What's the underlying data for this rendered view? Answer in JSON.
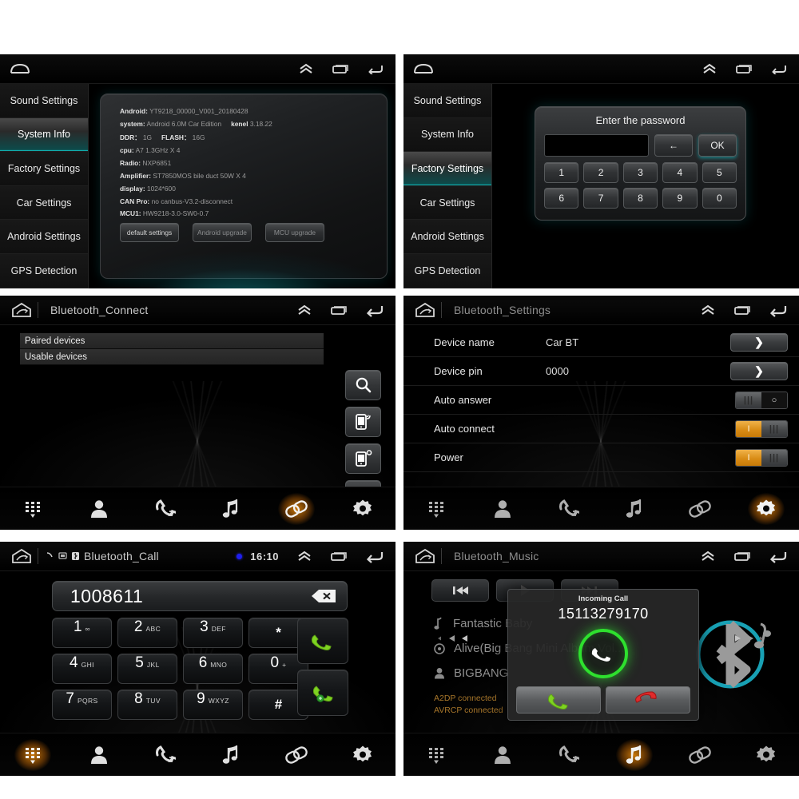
{
  "panels": {
    "system_info": {
      "statusbar": {
        "home_icon": "home-icon",
        "up_icon": "chevron-up-icon",
        "recents_icon": "recents-icon",
        "back_icon": "back-icon"
      },
      "sidebar": [
        {
          "label": "Sound Settings",
          "active": false
        },
        {
          "label": "System Info",
          "active": true
        },
        {
          "label": "Factory Settings",
          "active": false
        },
        {
          "label": "Car Settings",
          "active": false
        },
        {
          "label": "Android Settings",
          "active": false
        },
        {
          "label": "GPS Detection",
          "active": false
        }
      ],
      "info": [
        {
          "key": "Android:",
          "value": "YT9218_00000_V001_20180428"
        },
        {
          "key": "system:",
          "value": "Android 6.0M Car Edition",
          "key2": "kenel",
          "value2": "3.18.22"
        },
        {
          "key": "DDR：",
          "value": "1G",
          "key2": "FLASH：",
          "value2": "16G"
        },
        {
          "key": "cpu:",
          "value": "A7 1.3GHz X 4"
        },
        {
          "key": "Radio:",
          "value": "NXP6851"
        },
        {
          "key": "Amplifier:",
          "value": "ST7850MOS bile duct 50W X 4"
        },
        {
          "key": "display:",
          "value": "1024*600"
        },
        {
          "key": "CAN Pro:",
          "value": "no canbus-V3.2-disconnect"
        },
        {
          "key": "MCU1:",
          "value": "HW9218-3.0-SW0-0.7"
        }
      ],
      "buttons": [
        {
          "label": "default settings",
          "muted": false
        },
        {
          "label": "Android upgrade",
          "muted": true
        },
        {
          "label": "MCU upgrade",
          "muted": true
        }
      ]
    },
    "password": {
      "sidebar": [
        {
          "label": "Sound Settings",
          "active": false
        },
        {
          "label": "System Info",
          "active": false
        },
        {
          "label": "Factory Settings",
          "active": true
        },
        {
          "label": "Car Settings",
          "active": false
        },
        {
          "label": "Android Settings",
          "active": false
        },
        {
          "label": "GPS Detection",
          "active": false
        }
      ],
      "dialog": {
        "title": "Enter the password",
        "input_value": "",
        "backspace_label": "←",
        "ok_label": "OK",
        "keys": [
          "1",
          "2",
          "3",
          "4",
          "5",
          "6",
          "7",
          "8",
          "9",
          "0"
        ]
      }
    },
    "bt_connect": {
      "title": "Bluetooth_Connect",
      "device_groups": [
        "Paired devices",
        "Usable devices"
      ],
      "actions": [
        {
          "name": "search-icon"
        },
        {
          "name": "phone-connect-icon"
        },
        {
          "name": "phone-disconnect-icon"
        },
        {
          "name": "trash-icon"
        }
      ],
      "nav": [
        {
          "name": "dialpad-icon",
          "active": false
        },
        {
          "name": "contacts-icon",
          "active": false
        },
        {
          "name": "call-history-icon",
          "active": false
        },
        {
          "name": "music-icon",
          "active": false
        },
        {
          "name": "link-icon",
          "active": true
        },
        {
          "name": "settings-icon",
          "active": false
        }
      ]
    },
    "bt_settings": {
      "title": "Bluetooth_Settings",
      "rows": [
        {
          "label": "Device name",
          "value": "Car BT",
          "control": "arrow",
          "arrow_label": "❯"
        },
        {
          "label": "Device pin",
          "value": "0000",
          "control": "arrow",
          "arrow_label": "❯"
        },
        {
          "label": "Auto answer",
          "value": "",
          "control": "toggle",
          "state": "off",
          "on_label": "I",
          "off_label": "|||",
          "circle_label": "○"
        },
        {
          "label": "Auto connect",
          "value": "",
          "control": "toggle",
          "state": "on",
          "on_label": "I",
          "off_label": "|||"
        },
        {
          "label": "Power",
          "value": "",
          "control": "toggle",
          "state": "on",
          "on_label": "I",
          "off_label": "|||"
        }
      ],
      "nav": [
        {
          "name": "dialpad-icon",
          "active": false
        },
        {
          "name": "contacts-icon",
          "active": false
        },
        {
          "name": "call-history-icon",
          "active": false
        },
        {
          "name": "music-icon",
          "active": false
        },
        {
          "name": "link-icon",
          "active": false
        },
        {
          "name": "settings-icon",
          "active": true
        }
      ]
    },
    "bt_call": {
      "title": "Bluetooth_Call",
      "time": "16:10",
      "bt_dot": true,
      "number": "1008611",
      "backspace_icon": "backspace-icon",
      "keys": [
        {
          "num": "1",
          "sub": "∞",
          "symbol": false
        },
        {
          "num": "2",
          "sub": "ABC",
          "symbol": false
        },
        {
          "num": "3",
          "sub": "DEF",
          "symbol": false
        },
        {
          "num": "*",
          "sub": "",
          "symbol": true
        },
        {
          "num": "4",
          "sub": "GHI",
          "symbol": false
        },
        {
          "num": "5",
          "sub": "JKL",
          "symbol": false
        },
        {
          "num": "6",
          "sub": "MNO",
          "symbol": false
        },
        {
          "num": "0",
          "sub": "+",
          "symbol": false
        },
        {
          "num": "7",
          "sub": "PQRS",
          "symbol": false
        },
        {
          "num": "8",
          "sub": "TUV",
          "symbol": false
        },
        {
          "num": "9",
          "sub": "WXYZ",
          "symbol": false
        },
        {
          "num": "#",
          "sub": "",
          "symbol": true
        }
      ],
      "call_buttons": [
        {
          "name": "call-button"
        },
        {
          "name": "call-transfer-button"
        }
      ],
      "nav": [
        {
          "name": "dialpad-icon",
          "active": true
        },
        {
          "name": "contacts-icon",
          "active": false
        },
        {
          "name": "call-history-icon",
          "active": false
        },
        {
          "name": "music-icon",
          "active": false
        },
        {
          "name": "link-icon",
          "active": false
        },
        {
          "name": "settings-icon",
          "active": false
        }
      ]
    },
    "bt_music": {
      "title": "Bluetooth_Music",
      "media_buttons": [
        {
          "name": "previous-track-icon"
        },
        {
          "name": "play-icon"
        },
        {
          "name": "next-track-icon"
        }
      ],
      "tracks": [
        {
          "icon": "note-icon",
          "text": "Fantastic Baby"
        },
        {
          "icon": "album-icon",
          "text": "Alive(Big Bang Mini Album Vol..."
        },
        {
          "icon": "artist-icon",
          "text": "BIGBANG"
        }
      ],
      "status": [
        "A2DP connected",
        "AVRCP connected"
      ],
      "incoming_call": {
        "title": "Incoming Call",
        "number": "15113279170",
        "accept_label": "accept-call-button",
        "reject_label": "reject-call-button"
      },
      "nav": [
        {
          "name": "dialpad-icon",
          "active": false
        },
        {
          "name": "contacts-icon",
          "active": false
        },
        {
          "name": "call-history-icon",
          "active": false
        },
        {
          "name": "music-icon",
          "active": true
        },
        {
          "name": "link-icon",
          "active": false
        },
        {
          "name": "settings-icon",
          "active": false
        }
      ]
    }
  },
  "colors": {
    "accent_cyan": "#13d8d8",
    "accent_orange": "#ff960a",
    "call_green": "#2ee02e",
    "reject_red": "#e02b2b",
    "bt_blue": "#1e9fb0",
    "status_amber": "#a7762a"
  }
}
